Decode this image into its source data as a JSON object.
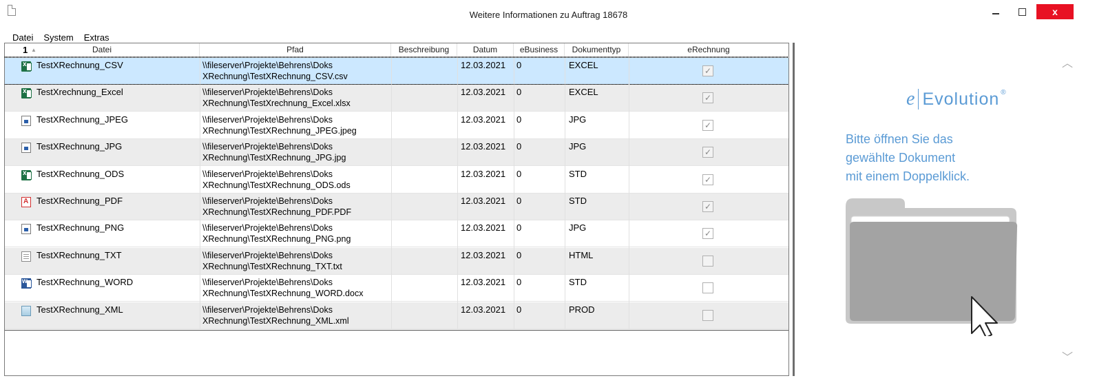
{
  "window": {
    "title": "Weitere Informationen zu Auftrag 18678",
    "close_label": "x"
  },
  "menu": [
    "Datei",
    "System",
    "Extras"
  ],
  "grid": {
    "sort_indicator": "1",
    "columns": [
      "Datei",
      "Pfad",
      "Beschreibung",
      "Datum",
      "eBusiness",
      "Dokumenttyp",
      "eRechnung"
    ],
    "rows": [
      {
        "icon": "excel-icon",
        "name": "TestXRechnung_CSV",
        "path1": "\\\\fileserver\\Projekte\\Behrens\\Doks",
        "path2": "XRechnung\\TestXRechnung_CSV.csv",
        "desc": "",
        "date": "12.03.2021",
        "ebusiness": "0",
        "type": "EXCEL",
        "erechnung": true
      },
      {
        "icon": "excel-icon",
        "name": "TestXrechnung_Excel",
        "path1": "\\\\fileserver\\Projekte\\Behrens\\Doks",
        "path2": "XRechnung\\TestXrechnung_Excel.xlsx",
        "desc": "",
        "date": "12.03.2021",
        "ebusiness": "0",
        "type": "EXCEL",
        "erechnung": true
      },
      {
        "icon": "image-icon",
        "name": "TestXRechnung_JPEG",
        "path1": "\\\\fileserver\\Projekte\\Behrens\\Doks",
        "path2": "XRechnung\\TestXRechnung_JPEG.jpeg",
        "desc": "",
        "date": "12.03.2021",
        "ebusiness": "0",
        "type": "JPG",
        "erechnung": true
      },
      {
        "icon": "image-icon",
        "name": "TestXRechnung_JPG",
        "path1": "\\\\fileserver\\Projekte\\Behrens\\Doks",
        "path2": "XRechnung\\TestXRechnung_JPG.jpg",
        "desc": "",
        "date": "12.03.2021",
        "ebusiness": "0",
        "type": "JPG",
        "erechnung": true
      },
      {
        "icon": "excel-icon",
        "name": "TestXRechnung_ODS",
        "path1": "\\\\fileserver\\Projekte\\Behrens\\Doks",
        "path2": "XRechnung\\TestXRechnung_ODS.ods",
        "desc": "",
        "date": "12.03.2021",
        "ebusiness": "0",
        "type": "STD",
        "erechnung": true
      },
      {
        "icon": "pdf-icon",
        "name": "TestXRechnung_PDF",
        "path1": "\\\\fileserver\\Projekte\\Behrens\\Doks",
        "path2": "XRechnung\\TestXRechnung_PDF.PDF",
        "desc": "",
        "date": "12.03.2021",
        "ebusiness": "0",
        "type": "STD",
        "erechnung": true
      },
      {
        "icon": "image-icon",
        "name": "TestXRechnung_PNG",
        "path1": "\\\\fileserver\\Projekte\\Behrens\\Doks",
        "path2": "XRechnung\\TestXRechnung_PNG.png",
        "desc": "",
        "date": "12.03.2021",
        "ebusiness": "0",
        "type": "JPG",
        "erechnung": true
      },
      {
        "icon": "text-file-icon",
        "name": "TestXRechnung_TXT",
        "path1": "\\\\fileserver\\Projekte\\Behrens\\Doks",
        "path2": "XRechnung\\TestXRechnung_TXT.txt",
        "desc": "",
        "date": "12.03.2021",
        "ebusiness": "0",
        "type": "HTML",
        "erechnung": false
      },
      {
        "icon": "word-icon",
        "name": "TestXRechnung_WORD",
        "path1": "\\\\fileserver\\Projekte\\Behrens\\Doks",
        "path2": "XRechnung\\TestXRechnung_WORD.docx",
        "desc": "",
        "date": "12.03.2021",
        "ebusiness": "0",
        "type": "STD",
        "erechnung": false
      },
      {
        "icon": "xml-icon",
        "name": "TestXRechnung_XML",
        "path1": "\\\\fileserver\\Projekte\\Behrens\\Doks",
        "path2": "XRechnung\\TestXRechnung_XML.xml",
        "desc": "",
        "date": "12.03.2021",
        "ebusiness": "0",
        "type": "PROD",
        "erechnung": false
      }
    ],
    "selected_row": 0
  },
  "panel": {
    "brand_e": "e",
    "brand_name": "Evolution",
    "brand_reg": "®",
    "hint_lines": [
      "Bitte öffnen Sie das",
      "gewählte Dokument",
      "mit einem Doppelklick."
    ]
  },
  "colors": {
    "accent": "#5b9bd5",
    "selection": "#cce8ff",
    "alt_row": "#ececec",
    "close_button": "#e81123",
    "excel": "#1e7145",
    "word": "#2b579a",
    "pdf": "#d32f2f"
  }
}
